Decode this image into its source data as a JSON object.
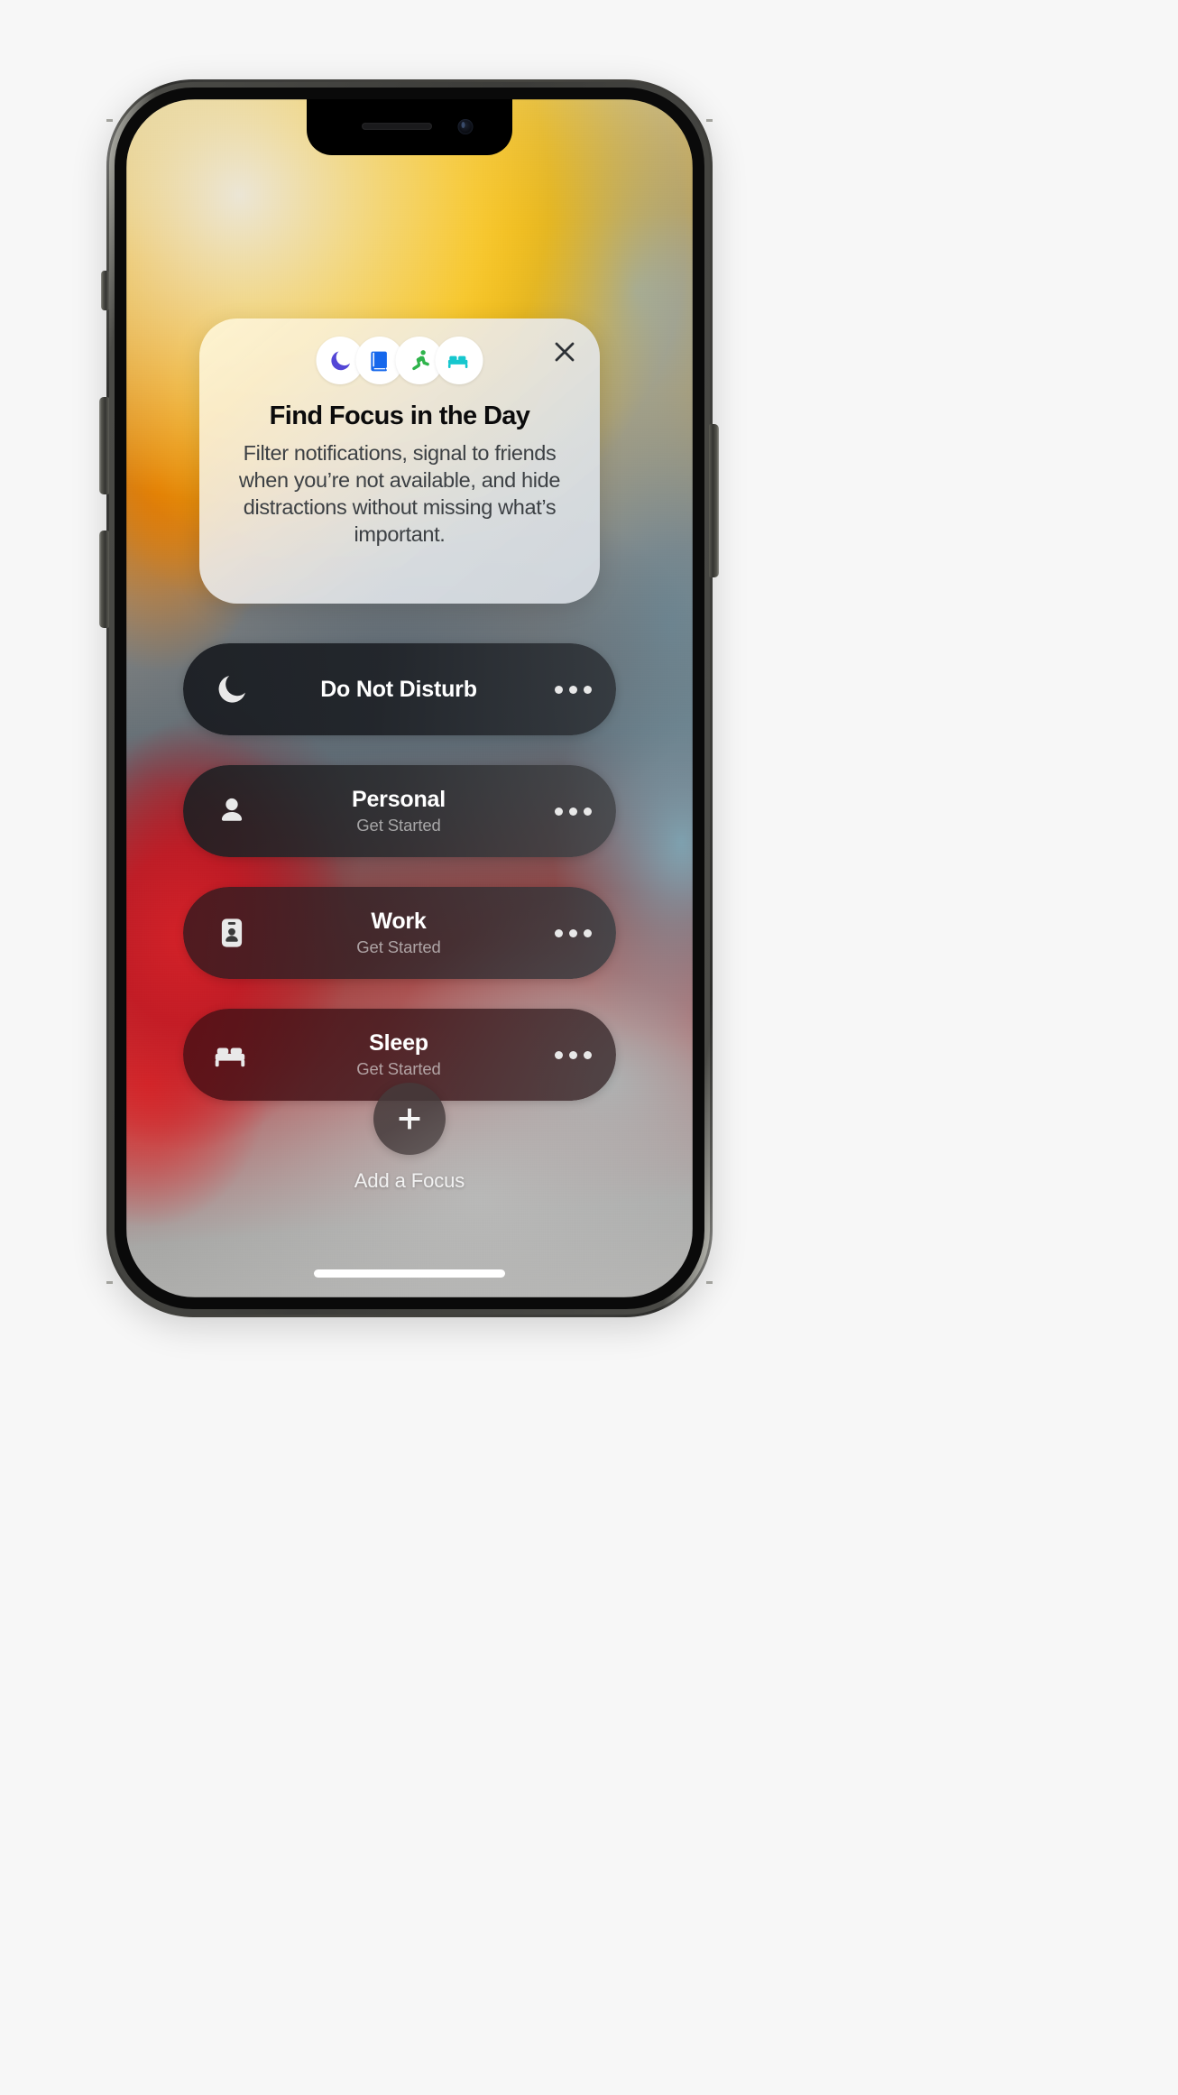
{
  "device": {
    "name": "iPhone",
    "notch": {
      "speaker": "earpiece-speaker",
      "camera": "front-camera"
    },
    "buttons": {
      "mute": "Ring/Silent switch",
      "volume_up": "Volume Up",
      "volume_down": "Volume Down",
      "power": "Side button"
    },
    "home_indicator": "home-indicator"
  },
  "promo_card": {
    "close_label": "Close",
    "title": "Find Focus in the Day",
    "body": "Filter notifications, signal to friends when you’re not available, and hide distractions without missing what’s important.",
    "icons": [
      {
        "name": "moon-icon",
        "label": "Do Not Disturb",
        "color": "#5346D6"
      },
      {
        "name": "book-icon",
        "label": "Reading",
        "color": "#1668EC"
      },
      {
        "name": "runner-icon",
        "label": "Fitness",
        "color": "#2FB44C"
      },
      {
        "name": "bed-icon",
        "label": "Sleep",
        "color": "#16C7CE"
      }
    ]
  },
  "focus_list": [
    {
      "id": "do-not-disturb",
      "icon": "moon-icon",
      "title": "Do Not Disturb",
      "subtitle": "",
      "more_label": "More options"
    },
    {
      "id": "personal",
      "icon": "person-icon",
      "title": "Personal",
      "subtitle": "Get Started",
      "more_label": "More options"
    },
    {
      "id": "work",
      "icon": "badge-icon",
      "title": "Work",
      "subtitle": "Get Started",
      "more_label": "More options"
    },
    {
      "id": "sleep",
      "icon": "bed-icon",
      "title": "Sleep",
      "subtitle": "Get Started",
      "more_label": "More options"
    }
  ],
  "add_focus": {
    "icon": "plus-icon",
    "label": "Add a Focus"
  },
  "colors": {
    "page_background": "#f7f7f7",
    "card_text_primary": "#0b0b0c",
    "card_text_secondary": "#3c4044",
    "row_title": "#ffffff",
    "row_subtitle": "rgba(236,236,236,0.62)",
    "moon_purple": "#5346D6",
    "book_blue": "#1668EC",
    "runner_green": "#2FB44C",
    "bed_teal": "#16C7CE"
  }
}
